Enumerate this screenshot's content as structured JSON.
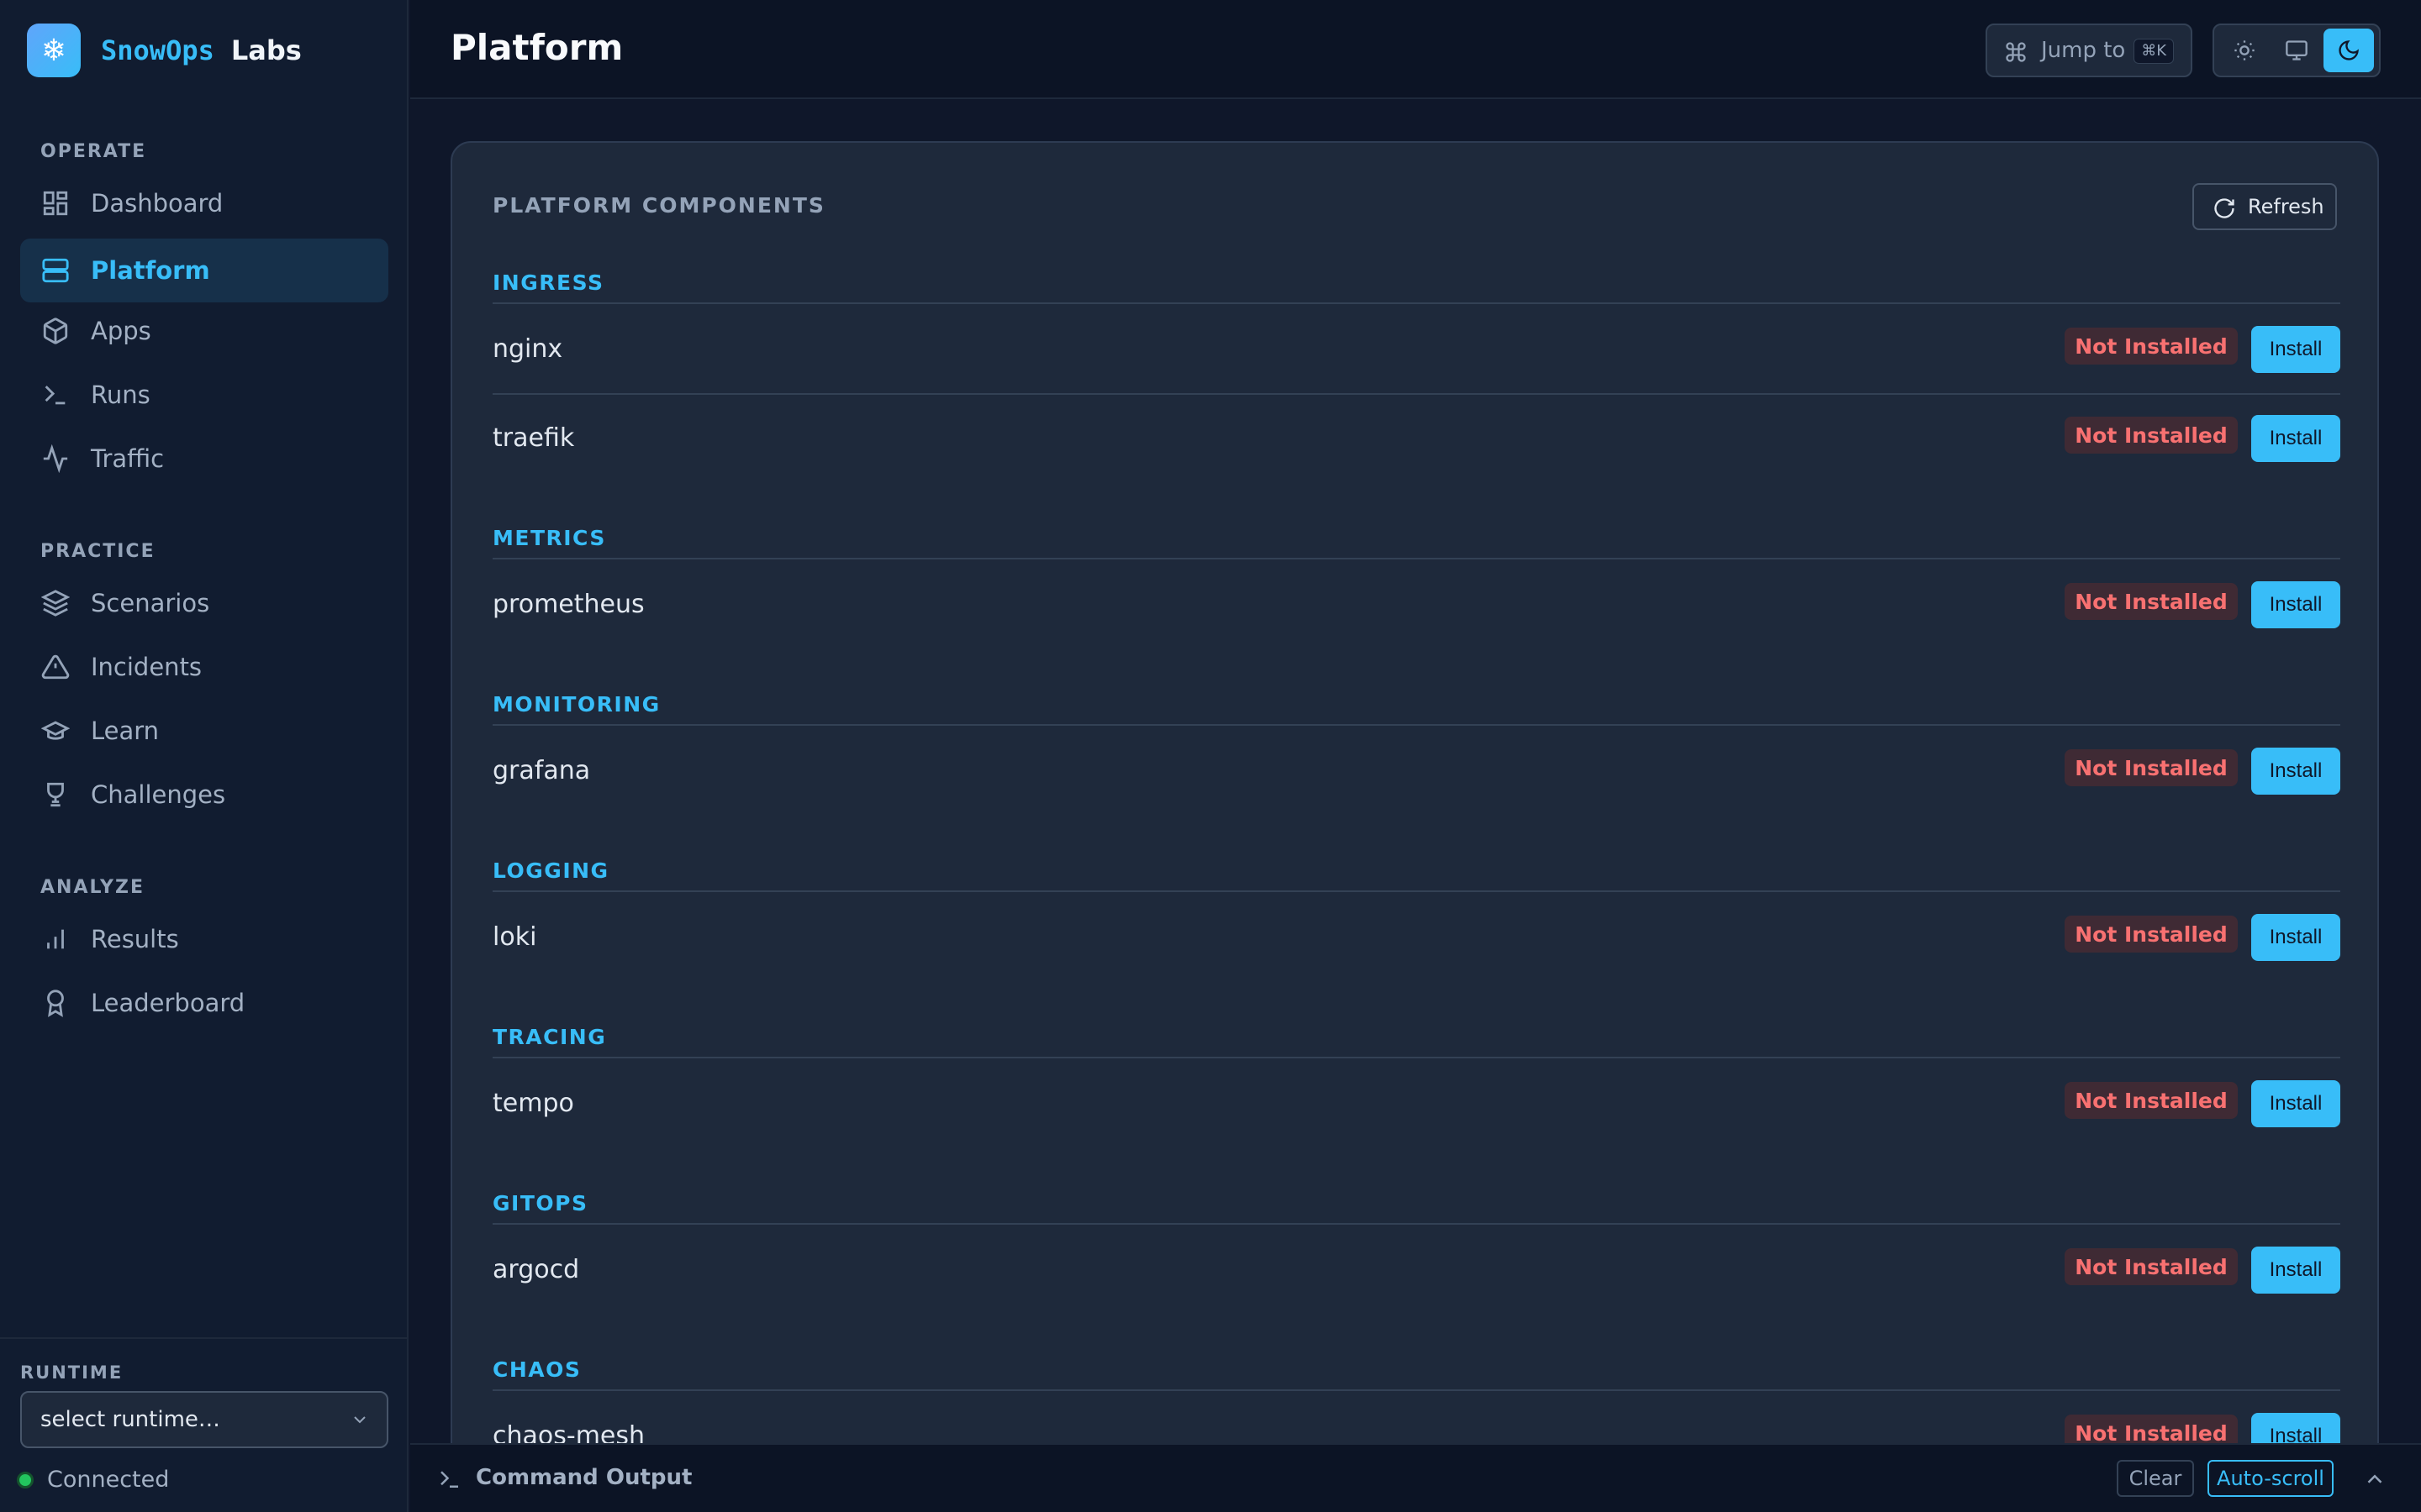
{
  "brand": {
    "logo_glyph": "❄",
    "name": "SnowOps",
    "sub": "Labs"
  },
  "sidebar": {
    "sections": [
      {
        "label": "OPERATE",
        "items": [
          {
            "label": "Dashboard",
            "icon": "dashboard-icon"
          },
          {
            "label": "Platform",
            "icon": "server-icon",
            "active": true
          },
          {
            "label": "Apps",
            "icon": "package-icon"
          },
          {
            "label": "Runs",
            "icon": "terminal-icon"
          },
          {
            "label": "Traffic",
            "icon": "activity-icon"
          }
        ]
      },
      {
        "label": "PRACTICE",
        "items": [
          {
            "label": "Scenarios",
            "icon": "layers-icon"
          },
          {
            "label": "Incidents",
            "icon": "alert-triangle-icon"
          },
          {
            "label": "Learn",
            "icon": "graduation-cap-icon"
          },
          {
            "label": "Challenges",
            "icon": "trophy-icon"
          }
        ]
      },
      {
        "label": "ANALYZE",
        "items": [
          {
            "label": "Results",
            "icon": "bar-chart-icon"
          },
          {
            "label": "Leaderboard",
            "icon": "award-icon"
          }
        ]
      }
    ],
    "runtime": {
      "label": "RUNTIME",
      "placeholder": "select runtime…",
      "status": "Connected",
      "status_color": "#22c55e"
    }
  },
  "header": {
    "title": "Platform",
    "jump_label": "Jump to",
    "jump_shortcut": "⌘K",
    "theme_modes": [
      "light",
      "system",
      "dark"
    ],
    "theme_selected": "dark"
  },
  "main": {
    "card_title": "PLATFORM COMPONENTS",
    "refresh_label": "Refresh",
    "groups": [
      {
        "name": "INGRESS",
        "components": [
          {
            "name": "nginx",
            "status": "Not Installed",
            "action": "Install"
          },
          {
            "name": "traefik",
            "status": "Not Installed",
            "action": "Install"
          }
        ]
      },
      {
        "name": "METRICS",
        "components": [
          {
            "name": "prometheus",
            "status": "Not Installed",
            "action": "Install"
          }
        ]
      },
      {
        "name": "MONITORING",
        "components": [
          {
            "name": "grafana",
            "status": "Not Installed",
            "action": "Install"
          }
        ]
      },
      {
        "name": "LOGGING",
        "components": [
          {
            "name": "loki",
            "status": "Not Installed",
            "action": "Install"
          }
        ]
      },
      {
        "name": "TRACING",
        "components": [
          {
            "name": "tempo",
            "status": "Not Installed",
            "action": "Install"
          }
        ]
      },
      {
        "name": "GITOPS",
        "components": [
          {
            "name": "argocd",
            "status": "Not Installed",
            "action": "Install"
          }
        ]
      },
      {
        "name": "CHAOS",
        "components": [
          {
            "name": "chaos-mesh",
            "status": "Not Installed",
            "action": "Install"
          }
        ]
      }
    ]
  },
  "output": {
    "title": "Command Output",
    "clear_label": "Clear",
    "autoscroll_label": "Auto-scroll"
  },
  "colors": {
    "accent": "#38bdf8",
    "danger": "#f87171",
    "sidebar_bg": "#111c30",
    "card_bg": "#1e293b"
  }
}
